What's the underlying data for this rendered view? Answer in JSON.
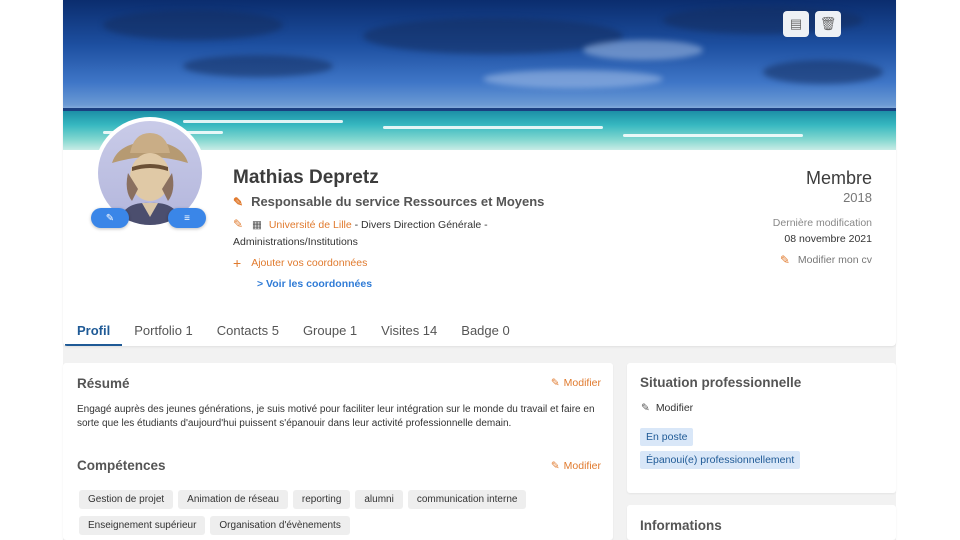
{
  "cover": {
    "actions": [
      {
        "name": "pdf-icon",
        "glyph": "▤"
      },
      {
        "name": "trash-icon",
        "glyph": "🗑"
      }
    ]
  },
  "avatar": {
    "edit_glyph": "✎",
    "menu_glyph": "≡"
  },
  "profile": {
    "name": "Mathias Depretz",
    "title": "Responsable du service Ressources et Moyens",
    "organization": "Université de Lille",
    "department": " - Divers Direction Générale - Administrations/Institutions",
    "add_contact": "Ajouter vos coordonnées",
    "see_contact": "> Voir les coordonnées"
  },
  "membership": {
    "label": "Membre",
    "year": "2018",
    "last_modified_label": "Dernière modification",
    "last_modified_date": "08 novembre 2021",
    "edit_cv": "Modifier mon cv"
  },
  "tabs": [
    {
      "label": "Profil",
      "active": true
    },
    {
      "label": "Portfolio 1",
      "active": false
    },
    {
      "label": "Contacts 5",
      "active": false
    },
    {
      "label": "Groupe 1",
      "active": false
    },
    {
      "label": "Visites 14",
      "active": false
    },
    {
      "label": "Badge 0",
      "active": false
    }
  ],
  "resume": {
    "title": "Résumé",
    "edit": "Modifier",
    "text": "Engagé auprès des jeunes générations, je suis motivé pour faciliter leur intégration sur le monde du travail et faire en sorte que les étudiants d'aujourd'hui puissent s'épanouir dans leur activité professionnelle demain."
  },
  "skills": {
    "title": "Compétences",
    "edit": "Modifier",
    "tags": [
      "Gestion de projet",
      "Animation de réseau",
      "reporting",
      "alumni",
      "communication interne",
      "Enseignement supérieur",
      "Organisation d'évènements"
    ]
  },
  "situation": {
    "title": "Situation professionnelle",
    "edit": "Modifier",
    "tags": [
      "En poste",
      "Épanoui(e) professionnellement"
    ]
  },
  "informations": {
    "title": "Informations"
  },
  "colors": {
    "accent_orange": "#e07a2e",
    "link_blue": "#2f7bd6",
    "tab_active": "#1f5a96"
  }
}
